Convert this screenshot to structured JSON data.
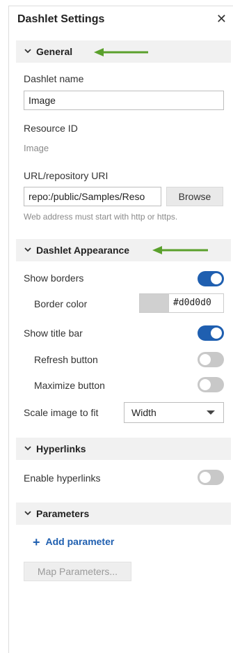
{
  "header": {
    "title": "Dashlet Settings",
    "close_glyph": "✕"
  },
  "sections": {
    "general": {
      "label": "General"
    },
    "appearance": {
      "label": "Dashlet Appearance"
    },
    "hyperlinks": {
      "label": "Hyperlinks"
    },
    "parameters": {
      "label": "Parameters"
    }
  },
  "general": {
    "dashlet_name_label": "Dashlet name",
    "dashlet_name_value": "Image",
    "resource_id_label": "Resource ID",
    "resource_id_value": "Image",
    "url_label": "URL/repository URI",
    "url_value": "repo:/public/Samples/Reso",
    "browse_label": "Browse",
    "url_hint": "Web address must start with http or https."
  },
  "appearance": {
    "show_borders_label": "Show borders",
    "show_borders": true,
    "border_color_label": "Border color",
    "border_color_value": "#d0d0d0",
    "show_title_bar_label": "Show title bar",
    "show_title_bar": true,
    "refresh_button_label": "Refresh button",
    "refresh_button": false,
    "maximize_button_label": "Maximize button",
    "maximize_button": false,
    "scale_label": "Scale image to fit",
    "scale_value": "Width"
  },
  "hyperlinks": {
    "enable_label": "Enable hyperlinks",
    "enabled": false
  },
  "parameters": {
    "add_label": "Add parameter",
    "map_label": "Map Parameters..."
  },
  "colors": {
    "accent": "#1f5fb0",
    "toggle_off": "#c8c8c8",
    "annotation_arrow": "#5aa02c",
    "section_bg": "#f1f1f1"
  }
}
